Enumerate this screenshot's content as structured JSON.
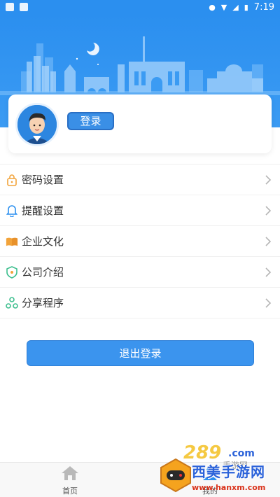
{
  "status_bar": {
    "time": "7:19"
  },
  "profile": {
    "login_label": "登录"
  },
  "menu": {
    "items": [
      {
        "label": "密码设置",
        "icon": "lock-icon"
      },
      {
        "label": "提醒设置",
        "icon": "bell-icon"
      },
      {
        "label": "企业文化",
        "icon": "book-icon"
      },
      {
        "label": "公司介绍",
        "icon": "shield-icon"
      },
      {
        "label": "分享程序",
        "icon": "share-icon"
      }
    ]
  },
  "logout_label": "退出登录",
  "tabbar": {
    "home_label": "首页",
    "mine_label": "我的"
  },
  "watermark": {
    "brand": "289",
    "com": ".com",
    "cn_name": "西美手游网",
    "subtitle": "手游网",
    "url": "www.hanxm.com"
  },
  "colors": {
    "primary": "#2b8fef",
    "button": "#3b94ee",
    "accent_orange": "#f2a33a",
    "accent_green": "#3fbf8f"
  }
}
